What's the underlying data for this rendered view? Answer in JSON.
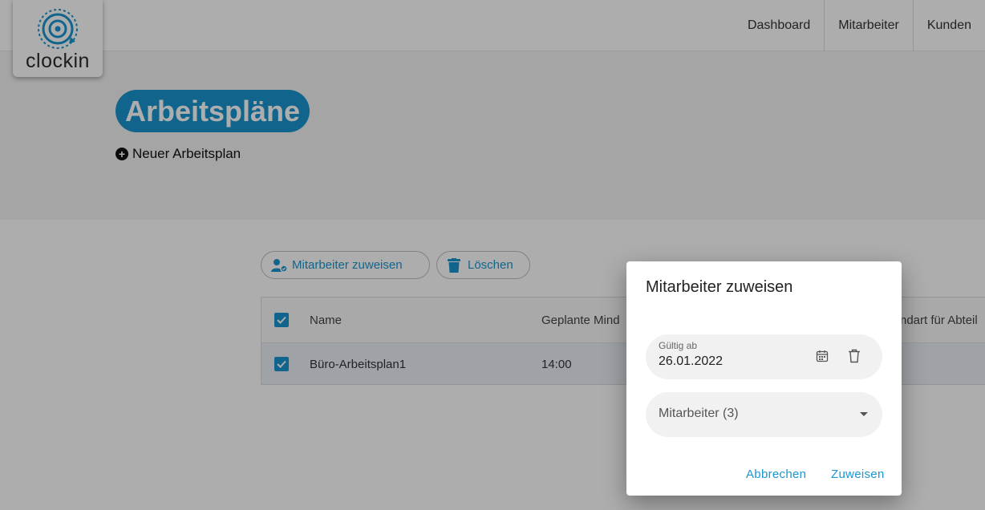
{
  "brand": {
    "logo_text": "clockin",
    "accent_color": "#1a96d0"
  },
  "nav": {
    "items": [
      "Dashboard",
      "Mitarbeiter",
      "Kunden"
    ]
  },
  "page": {
    "title": "Arbeitspläne",
    "new_plan_label": "Neuer Arbeitsplan"
  },
  "toolbar": {
    "assign_label": "Mitarbeiter zuweisen",
    "delete_label": "Löschen"
  },
  "table": {
    "headers": [
      "Name",
      "Geplante Mind",
      "ndart für Abteil"
    ],
    "rows": [
      {
        "name": "Büro-Arbeitsplan1",
        "planned": "14:00",
        "checked": true
      }
    ],
    "select_all_checked": true
  },
  "dialog": {
    "title": "Mitarbeiter zuweisen",
    "date_label": "Gültig ab",
    "date_value": "26.01.2022",
    "employee_select_value": "Mitarbeiter (3)",
    "cancel_label": "Abbrechen",
    "confirm_label": "Zuweisen"
  },
  "icons": [
    "clockin-logo-icon",
    "plus-circle-icon",
    "user-assign-icon",
    "trash-icon",
    "checkbox-checked-icon",
    "calendar-icon",
    "chevron-down-icon"
  ]
}
